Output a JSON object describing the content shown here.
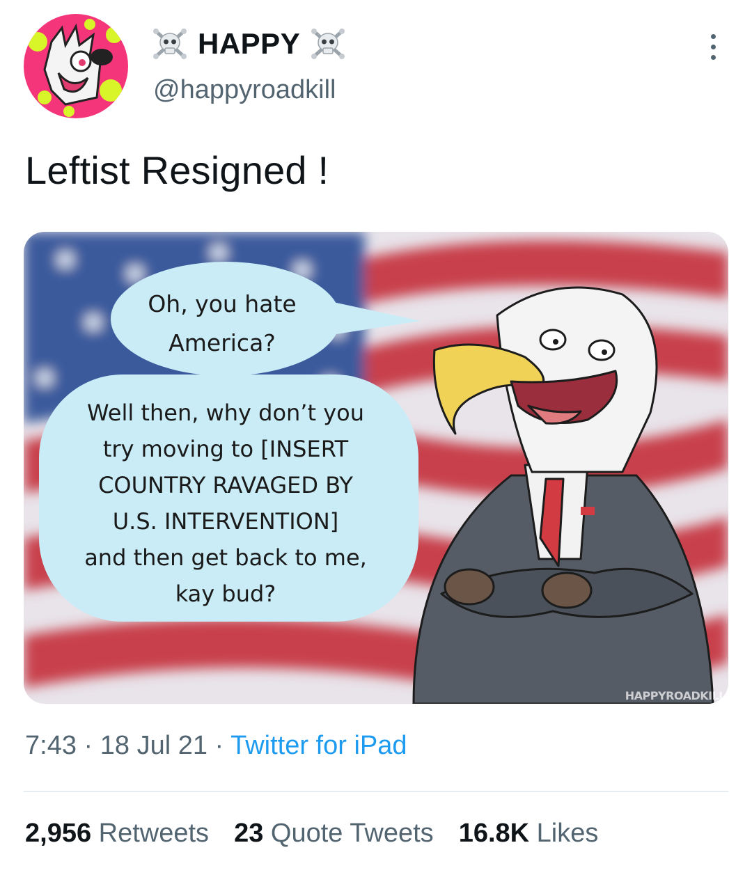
{
  "user": {
    "display_name": "HAPPY",
    "handle": "@happyroadkill",
    "name_emoji": "skull-and-crossbones-icon"
  },
  "tweet": {
    "text": "Leftist Resigned !"
  },
  "media": {
    "bubble_1": [
      "Oh, you hate",
      "America?"
    ],
    "bubble_2": [
      "Well then, why don’t you",
      "try moving to [INSERT",
      "COUNTRY RAVAGED BY",
      "U.S. INTERVENTION]",
      "and then get back to me,",
      "kay bud?"
    ],
    "watermark": "HAPPYROADKILL"
  },
  "meta": {
    "time": "7:43",
    "separator": " · ",
    "date": "18 Jul 21",
    "source": "Twitter for iPad"
  },
  "stats": {
    "retweets_count": "2,956",
    "retweets_label": "Retweets",
    "quotes_count": "23",
    "quotes_label": "Quote Tweets",
    "likes_count": "16.8K",
    "likes_label": "Likes"
  },
  "colors": {
    "link": "#1d9bf0",
    "secondary_text": "#536471",
    "bubble": "#c9ecf6",
    "flag_red": "#c8404c",
    "flag_blue": "#3a5a9c"
  }
}
